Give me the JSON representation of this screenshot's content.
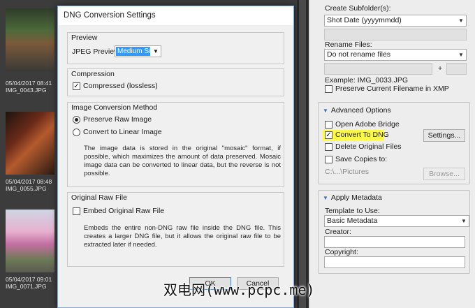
{
  "thumbnails": [
    {
      "date": "05/04/2017 08:41",
      "file": "IMG_0043.JPG",
      "photo": "green-outdoor-photo"
    },
    {
      "date": "05/04/2017 08:48",
      "file": "IMG_0055.JPG",
      "photo": "brick-wall-photo"
    },
    {
      "date": "05/04/2017 09:01",
      "file": "IMG_0071.JPG",
      "photo": "cherry-blossom-photo"
    }
  ],
  "right_panel": {
    "create_subfolder": {
      "label": "Create Subfolder(s):",
      "value": "Shot Date (yyyymmdd)"
    },
    "rename_files": {
      "label": "Rename Files:",
      "value": "Do not rename files",
      "plus": "+"
    },
    "example": "Example:  IMG_0033.JPG",
    "preserve_filename": {
      "label": "Preserve Current Filename in XMP",
      "checked": false
    },
    "advanced_options": {
      "title": "Advanced Options",
      "open_bridge": {
        "label": "Open Adobe Bridge",
        "checked": false
      },
      "convert_dng": {
        "label": "Convert To DNG",
        "checked": true
      },
      "settings_button": "Settings...",
      "delete_originals": {
        "label": "Delete Original Files",
        "checked": false
      },
      "save_copies": {
        "label": "Save Copies to:",
        "checked": false
      },
      "save_path": "C:\\...\\Pictures",
      "browse_button": "Browse..."
    },
    "apply_metadata": {
      "title": "Apply Metadata",
      "template_label": "Template to Use:",
      "template_value": "Basic Metadata",
      "creator_label": "Creator:",
      "copyright_label": "Copyright:"
    }
  },
  "dialog": {
    "title": "DNG Conversion Settings",
    "preview": {
      "title": "Preview",
      "jpeg_label": "JPEG Preview:",
      "jpeg_value": "Medium Size"
    },
    "compression": {
      "title": "Compression",
      "label": "Compressed (lossless)",
      "checked": true
    },
    "conversion": {
      "title": "Image Conversion Method",
      "preserve_raw": "Preserve Raw Image",
      "convert_linear": "Convert to Linear Image",
      "selected": "Preserve Raw Image",
      "description": "The image data is stored in the original \"mosaic\" format, if possible, which maximizes the amount of data preserved. Mosaic image data can be converted to linear data, but the reverse is not possible."
    },
    "original_raw": {
      "title": "Original Raw File",
      "embed_label": "Embed Original Raw File",
      "checked": false,
      "description": "Embeds the entire non-DNG raw file inside the DNG file. This creates a larger DNG file, but it allows the original raw file to be extracted later if needed."
    },
    "ok_button": "OK",
    "cancel_button": "Cancel"
  },
  "watermark": "双电网(www.pcpc.me)",
  "colors": {
    "highlight": "#fff94a",
    "accent": "#3399ff",
    "triangle": "#3e6fb6"
  }
}
